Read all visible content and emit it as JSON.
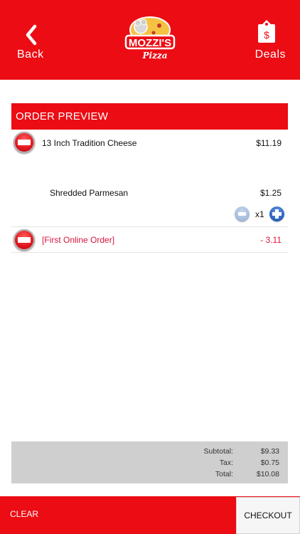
{
  "header": {
    "back_label": "Back",
    "deals_label": "Deals",
    "logo_text": "MOZZI'S",
    "logo_sub": "Pizza",
    "brand_color": "#ec0c14"
  },
  "order": {
    "section_title": "ORDER PREVIEW",
    "items": [
      {
        "name": "13 Inch Tradition Cheese",
        "price": "$11.19"
      },
      {
        "name": "Shredded Parmesan",
        "price": "$1.25",
        "quantity": "x1"
      },
      {
        "name": "[First Online Order]",
        "price": "- 3.11"
      }
    ]
  },
  "totals": {
    "subtotal_label": "Subtotal:",
    "subtotal": "$9.33",
    "tax_label": "Tax:",
    "tax": "$0.75",
    "total_label": "Total:",
    "total": "$10.08"
  },
  "footer": {
    "clear_label": "CLEAR",
    "checkout_label": "CHECKOUT"
  },
  "icons": {
    "back": "chevron-left-icon",
    "deals": "price-tag-icon",
    "remove": "remove-circle-icon",
    "decrease": "minus-circle-icon",
    "increase": "plus-circle-icon"
  }
}
